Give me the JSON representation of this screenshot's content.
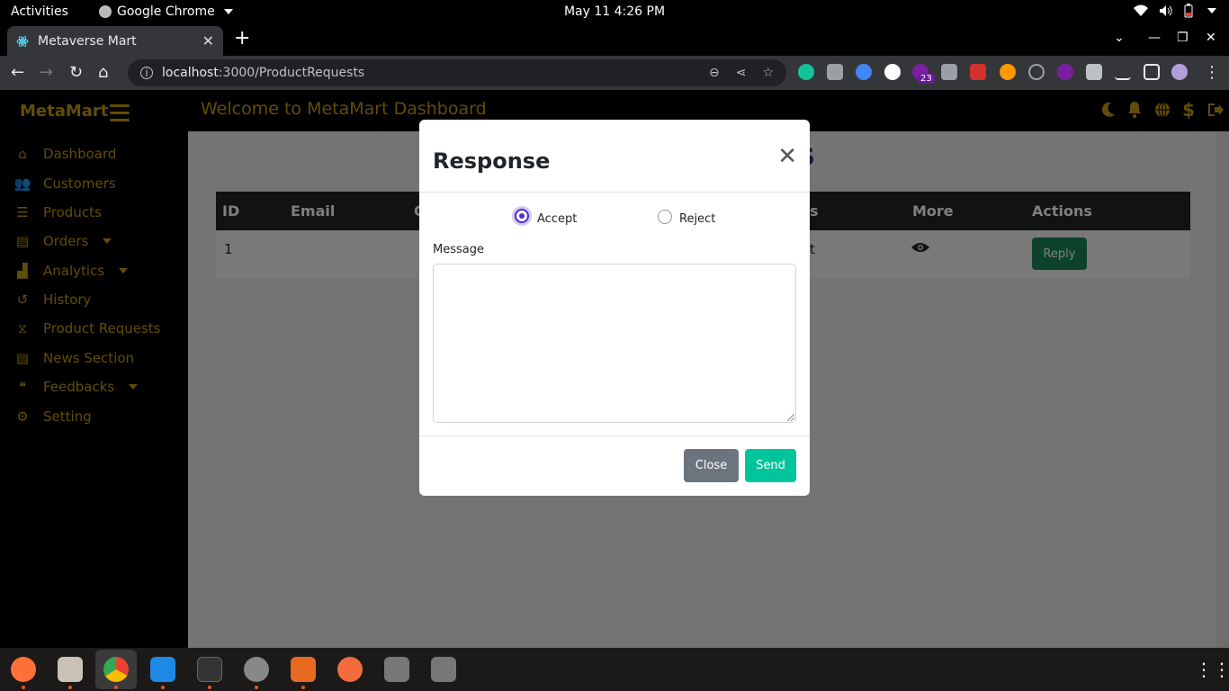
{
  "system": {
    "activities": "Activities",
    "app_name": "Google Chrome",
    "datetime": "May 11  4:26 PM"
  },
  "browser": {
    "tab_title": "Metaverse Mart",
    "url_host": "localhost",
    "url_path": ":3000/ProductRequests",
    "extension_badge": "23"
  },
  "app": {
    "brand": "MetaMart",
    "welcome": "Welcome to MetaMart Dashboard",
    "page_title_visible": "ts",
    "nav": [
      {
        "label": "Dashboard",
        "icon": "home-icon"
      },
      {
        "label": "Customers",
        "icon": "users-icon"
      },
      {
        "label": "Products",
        "icon": "list-icon"
      },
      {
        "label": "Orders",
        "icon": "orders-icon",
        "dropdown": true
      },
      {
        "label": "Analytics",
        "icon": "chart-icon",
        "dropdown": true
      },
      {
        "label": "History",
        "icon": "history-icon"
      },
      {
        "label": "Product Requests",
        "icon": "hourglass-icon"
      },
      {
        "label": "News Section",
        "icon": "news-icon"
      },
      {
        "label": "Feedbacks",
        "icon": "comments-icon",
        "dropdown": true
      },
      {
        "label": "Setting",
        "icon": "gear-icon"
      }
    ],
    "table": {
      "headers": [
        "ID",
        "Email",
        "C",
        "s",
        "More",
        "Actions"
      ],
      "rows": [
        {
          "id": "1",
          "partial": "t",
          "reply_label": "Reply"
        }
      ]
    },
    "colors": {
      "accent": "#c39b0f",
      "reply": "#198754",
      "send": "#00c59c"
    }
  },
  "modal": {
    "title": "Response",
    "options": [
      {
        "label": "Accept",
        "checked": true
      },
      {
        "label": "Reject",
        "checked": false
      }
    ],
    "message_label": "Message",
    "message_value": "",
    "close_label": "Close",
    "send_label": "Send"
  }
}
